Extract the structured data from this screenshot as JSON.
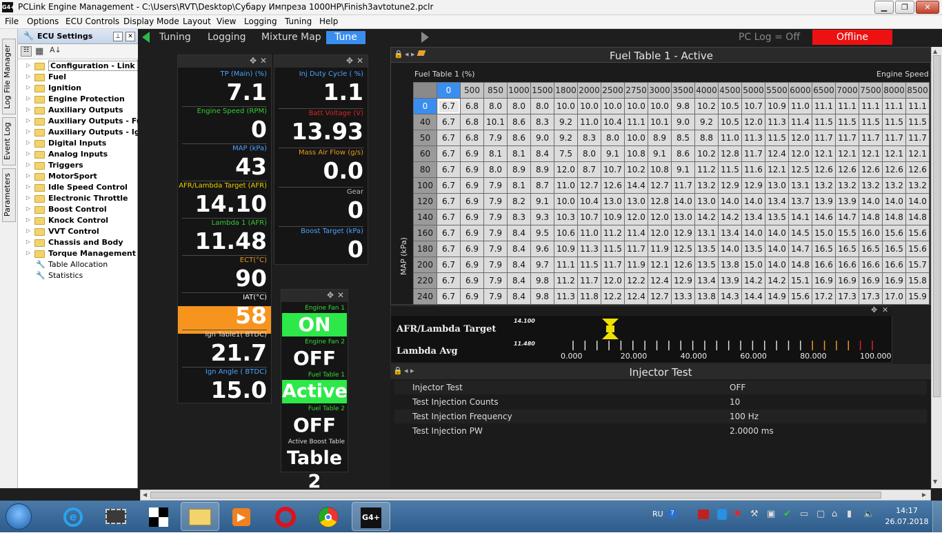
{
  "window": {
    "app_icon": "G4+",
    "title": "PCLink Engine Management - C:\\Users\\RVT\\Desktop\\Субару Импреза 1000HP\\Finish3avtotune2.pclr",
    "controls": [
      "minimize",
      "restore",
      "close"
    ]
  },
  "menu": [
    "File",
    "Options",
    "ECU Controls",
    "Display Mode",
    "Layout",
    "View",
    "Logging",
    "Tuning",
    "Help"
  ],
  "side_tabs": [
    "Log File Manager",
    "Event Log",
    "Parameters"
  ],
  "ecu_settings": {
    "title": "ECU Settings",
    "items": [
      {
        "label": "Configuration - Link defa",
        "type": "folder",
        "selected": true
      },
      {
        "label": "Fuel",
        "type": "folder"
      },
      {
        "label": "Ignition",
        "type": "folder"
      },
      {
        "label": "Engine Protection",
        "type": "folder"
      },
      {
        "label": "Auxiliary Outputs",
        "type": "folder"
      },
      {
        "label": "Auxiliary Outputs - Fuel",
        "type": "folder"
      },
      {
        "label": "Auxiliary Outputs - Ign",
        "type": "folder"
      },
      {
        "label": "Digital Inputs",
        "type": "folder"
      },
      {
        "label": "Analog Inputs",
        "type": "folder"
      },
      {
        "label": "Triggers",
        "type": "folder"
      },
      {
        "label": "MotorSport",
        "type": "folder"
      },
      {
        "label": "Idle Speed Control",
        "type": "folder"
      },
      {
        "label": "Electronic Throttle",
        "type": "folder"
      },
      {
        "label": "Boost Control",
        "type": "folder"
      },
      {
        "label": "Knock Control",
        "type": "folder"
      },
      {
        "label": "VVT Control",
        "type": "folder"
      },
      {
        "label": "Chassis and Body",
        "type": "folder"
      },
      {
        "label": "Torque Management",
        "type": "folder"
      },
      {
        "label": "Table Allocation",
        "type": "wrench"
      },
      {
        "label": "Statistics",
        "type": "wrench"
      }
    ]
  },
  "tabs": [
    {
      "label": "Tuning",
      "active": false
    },
    {
      "label": "Logging",
      "active": false
    },
    {
      "label": "Mixture Map",
      "active": false
    },
    {
      "label": "Tune",
      "active": true
    }
  ],
  "status": {
    "pc_log": "PC Log = Off",
    "connection": "Offline",
    "connection_color": "#ee1111"
  },
  "gauges_left": [
    {
      "label": "TP (Main) (%)",
      "value": "7.1",
      "label_color": "#4aa3ff"
    },
    {
      "label": "Engine Speed (RPM)",
      "value": "0",
      "label_color": "#33cc33"
    },
    {
      "label": "MAP (kPa)",
      "value": "43",
      "label_color": "#4aa3ff"
    },
    {
      "label": "AFR/Lambda Target (AFR)",
      "value": "14.10",
      "label_color": "#e8d000"
    },
    {
      "label": "Lambda 1 (AFR)",
      "value": "11.48",
      "label_color": "#33cc33"
    },
    {
      "label": "ECT(°C)",
      "value": "90",
      "label_color": "#e89a20"
    },
    {
      "label": "IAT(°C)",
      "value": "58",
      "label_color": "#ffffff",
      "highlight": "#f7941d"
    },
    {
      "label": "Ign Table1( BTDC)",
      "value": "21.7",
      "label_color": "#dddddd"
    },
    {
      "label": "Ign Angle ( BTDC)",
      "value": "15.0",
      "label_color": "#4aa3ff"
    }
  ],
  "gauges_mid": [
    {
      "label": "Inj Duty Cycle ( %)",
      "value": "1.1",
      "label_color": "#4aa3ff"
    },
    {
      "label": "Batt Voltage (V)",
      "value": "13.93",
      "label_color": "#dd2222"
    },
    {
      "label": "Mass Air Flow (g/s)",
      "value": "0.0",
      "label_color": "#e89a20"
    },
    {
      "label": "Gear",
      "value": "0",
      "label_color": "#bbbbbb"
    },
    {
      "label": "Boost Target (kPa)",
      "value": "0",
      "label_color": "#4aa3ff"
    }
  ],
  "indicators": [
    {
      "label": "Engine Fan 1",
      "value": "ON",
      "lit": true
    },
    {
      "label": "Engine Fan 2",
      "value": "OFF",
      "lit": false
    },
    {
      "label": "Fuel Table 1",
      "value": "Active",
      "lit": true
    },
    {
      "label": "Fuel Table 2",
      "value": "OFF",
      "lit": false
    },
    {
      "label": "Active Boost Table",
      "value": "Table 2",
      "lit": false
    }
  ],
  "fuel_table": {
    "title": "Fuel Table 1 - Active",
    "z_label": "Fuel Table 1 (%)",
    "x_label": "Engine Speed (",
    "y_label": "MAP (kPa)",
    "rpm": [
      "0",
      "500",
      "850",
      "1000",
      "1500",
      "1800",
      "2000",
      "2500",
      "2750",
      "3000",
      "3500",
      "4000",
      "4500",
      "5000",
      "5500",
      "6000",
      "6500",
      "7000",
      "7500",
      "8000",
      "8500"
    ],
    "map": [
      "0",
      "40",
      "50",
      "60",
      "80",
      "100",
      "120",
      "140",
      "160",
      "180",
      "200",
      "220",
      "240"
    ],
    "values": [
      [
        "6.7",
        "6.8",
        "8.0",
        "8.0",
        "8.0",
        "10.0",
        "10.0",
        "10.0",
        "10.0",
        "10.0",
        "9.8",
        "10.2",
        "10.5",
        "10.7",
        "10.9",
        "11.0",
        "11.1",
        "11.1",
        "11.1",
        "11.1",
        "11.1"
      ],
      [
        "6.7",
        "6.8",
        "10.1",
        "8.6",
        "8.3",
        "9.2",
        "11.0",
        "10.4",
        "11.1",
        "10.1",
        "9.0",
        "9.2",
        "10.5",
        "12.0",
        "11.3",
        "11.4",
        "11.5",
        "11.5",
        "11.5",
        "11.5",
        "11.5"
      ],
      [
        "6.7",
        "6.8",
        "7.9",
        "8.6",
        "9.0",
        "9.2",
        "8.3",
        "8.0",
        "10.0",
        "8.9",
        "8.5",
        "8.8",
        "11.0",
        "11.3",
        "11.5",
        "12.0",
        "11.7",
        "11.7",
        "11.7",
        "11.7",
        "11.7"
      ],
      [
        "6.7",
        "6.9",
        "8.1",
        "8.1",
        "8.4",
        "7.5",
        "8.0",
        "9.1",
        "10.8",
        "9.1",
        "8.6",
        "10.2",
        "12.8",
        "11.7",
        "12.4",
        "12.0",
        "12.1",
        "12.1",
        "12.1",
        "12.1",
        "12.1"
      ],
      [
        "6.7",
        "6.9",
        "8.0",
        "8.9",
        "8.9",
        "12.0",
        "8.7",
        "10.7",
        "10.2",
        "10.8",
        "9.1",
        "11.2",
        "11.5",
        "11.6",
        "12.1",
        "12.5",
        "12.6",
        "12.6",
        "12.6",
        "12.6",
        "12.6"
      ],
      [
        "6.7",
        "6.9",
        "7.9",
        "8.1",
        "8.7",
        "11.0",
        "12.7",
        "12.6",
        "14.4",
        "12.7",
        "11.7",
        "13.2",
        "12.9",
        "12.9",
        "13.0",
        "13.1",
        "13.2",
        "13.2",
        "13.2",
        "13.2",
        "13.2"
      ],
      [
        "6.7",
        "6.9",
        "7.9",
        "8.2",
        "9.1",
        "10.0",
        "10.4",
        "13.0",
        "13.0",
        "12.8",
        "14.0",
        "13.0",
        "14.0",
        "14.0",
        "13.4",
        "13.7",
        "13.9",
        "13.9",
        "14.0",
        "14.0",
        "14.0"
      ],
      [
        "6.7",
        "6.9",
        "7.9",
        "8.3",
        "9.3",
        "10.3",
        "10.7",
        "10.9",
        "12.0",
        "12.0",
        "13.0",
        "14.2",
        "14.2",
        "13.4",
        "13.5",
        "14.1",
        "14.6",
        "14.7",
        "14.8",
        "14.8",
        "14.8"
      ],
      [
        "6.7",
        "6.9",
        "7.9",
        "8.4",
        "9.5",
        "10.6",
        "11.0",
        "11.2",
        "11.4",
        "12.0",
        "12.9",
        "13.1",
        "13.4",
        "14.0",
        "14.0",
        "14.5",
        "15.0",
        "15.5",
        "16.0",
        "15.6",
        "15.6"
      ],
      [
        "6.7",
        "6.9",
        "7.9",
        "8.4",
        "9.6",
        "10.9",
        "11.3",
        "11.5",
        "11.7",
        "11.9",
        "12.5",
        "13.5",
        "14.0",
        "13.5",
        "14.0",
        "14.7",
        "16.5",
        "16.5",
        "16.5",
        "16.5",
        "15.6"
      ],
      [
        "6.7",
        "6.9",
        "7.9",
        "8.4",
        "9.7",
        "11.1",
        "11.5",
        "11.7",
        "11.9",
        "12.1",
        "12.6",
        "13.5",
        "13.8",
        "15.0",
        "14.0",
        "14.8",
        "16.6",
        "16.6",
        "16.6",
        "16.6",
        "15.7"
      ],
      [
        "6.7",
        "6.9",
        "7.9",
        "8.4",
        "9.8",
        "11.2",
        "11.7",
        "12.0",
        "12.2",
        "12.4",
        "12.9",
        "13.4",
        "13.9",
        "14.2",
        "14.2",
        "15.1",
        "16.9",
        "16.9",
        "16.9",
        "16.9",
        "15.8"
      ],
      [
        "6.7",
        "6.9",
        "7.9",
        "8.4",
        "9.8",
        "11.3",
        "11.8",
        "12.2",
        "12.4",
        "12.7",
        "13.3",
        "13.8",
        "14.3",
        "14.4",
        "14.9",
        "15.6",
        "17.2",
        "17.3",
        "17.3",
        "17.0",
        "15.9"
      ]
    ]
  },
  "afr_panel": {
    "target_label": "AFR/Lambda Target",
    "avg_label": "Lambda Avg",
    "target_value": "14.100",
    "avg_value": "11.480",
    "scale": [
      "0.000",
      "20.000",
      "40.000",
      "60.000",
      "80.000",
      "100.000"
    ]
  },
  "injector_test": {
    "title": "Injector Test",
    "rows": [
      {
        "key": "Injector Test",
        "value": "OFF"
      },
      {
        "key": "Test Injection Counts",
        "value": "10"
      },
      {
        "key": "Test Injection Frequency",
        "value": "100 Hz"
      },
      {
        "key": "Test Injection PW",
        "value": "2.0000 ms"
      }
    ]
  },
  "taskbar": {
    "apps": [
      "start-orb-icon",
      "ie-icon",
      "chip-icon",
      "checker-icon",
      "explorer-icon",
      "media-icon",
      "opera-icon",
      "chrome-icon",
      "g4-icon"
    ],
    "g4_label": "G4+",
    "lang": "RU",
    "time": "14:17",
    "date": "26.07.2018"
  }
}
